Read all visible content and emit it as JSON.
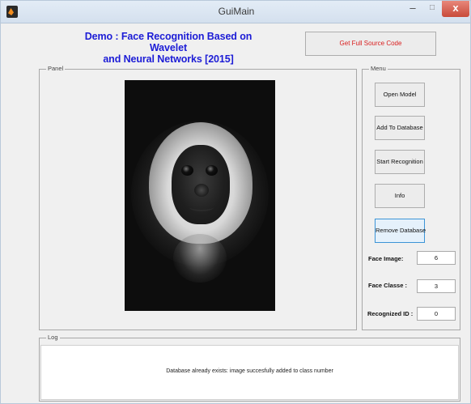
{
  "window": {
    "title": "GuiMain",
    "controls": {
      "minimize": "–",
      "maximize": "□",
      "close": "x"
    },
    "icon": "matlab-icon"
  },
  "header": {
    "title_line1": "Demo : Face Recognition Based on Wavelet",
    "title_line2": "and Neural Networks [2015]",
    "source_button": "Get Full Source Code",
    "accent_color": "#1c1cd6",
    "source_color": "#d91e1e"
  },
  "panel": {
    "label": "Panel",
    "image": "monkey-face-grayscale"
  },
  "menu": {
    "label": "Menu",
    "buttons": [
      "Open Model",
      "Add To Database",
      "Start Recognition",
      "Info",
      "Remove Database"
    ],
    "fields": [
      {
        "label": "Face Image:",
        "value": "6"
      },
      {
        "label": "Face Classe :",
        "value": "3"
      },
      {
        "label": "Recognized ID :",
        "value": "0"
      }
    ]
  },
  "log": {
    "label": "Log",
    "message": "Database already exists: image succesfully added to class number"
  }
}
